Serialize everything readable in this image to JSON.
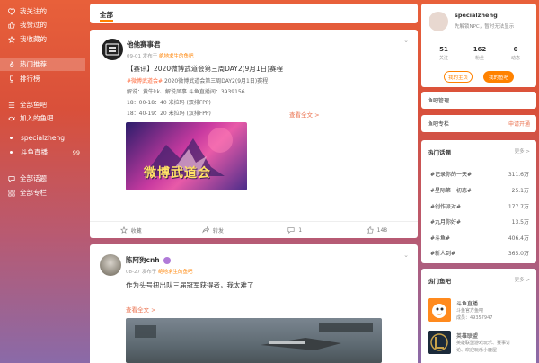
{
  "sidebar": {
    "items": [
      {
        "label": "我关注的",
        "icon": "heart-icon"
      },
      {
        "label": "我赞过的",
        "icon": "thumb-icon"
      },
      {
        "label": "我收藏的",
        "icon": "star-icon"
      },
      {
        "label": "热门推荐",
        "icon": "flame-icon"
      },
      {
        "label": "排行榜",
        "icon": "trophy-icon"
      },
      {
        "label": "全部鱼吧",
        "icon": "list-icon"
      },
      {
        "label": "加入的鱼吧",
        "icon": "fish-icon"
      },
      {
        "label": "specialzheng"
      },
      {
        "label": "斗鱼直播",
        "count": "99"
      },
      {
        "label": "全部话题",
        "icon": "chat-icon"
      },
      {
        "label": "全部专栏",
        "icon": "grid-icon"
      }
    ]
  },
  "feed": {
    "tab": "全部",
    "posts": [
      {
        "author": "他他赛事君",
        "date": "09-01",
        "from_prefix": "发布于",
        "source": "绝地求生的鱼吧",
        "title": "【赛讯】2020微博武道会第三周DAY2(9月1日)赛程",
        "tag": "#微博武道会#",
        "line1_rest": " 2020微博武道会第三周DAY2(9月1日)赛程:",
        "line2": "解说：黄牛kk、解说凤事   斗鱼直播间：3939156",
        "line3": "18：00-18：40  米拉玛 (双排FPP)",
        "line4": "18：40-19：20  米拉玛 (双排FPP)",
        "more": "查看全文 >",
        "image_text": "微博武道会",
        "actions": {
          "collect": "收藏",
          "share": "转发",
          "comment": "1",
          "like": "148"
        }
      },
      {
        "author": "陈阿狗cnh",
        "date": "08-27",
        "from_prefix": "发布于",
        "source": "绝地求生的鱼吧",
        "title": "作为头号扭出队三届冠军获得者，我太难了",
        "more": "查看全文 >"
      }
    ]
  },
  "profile": {
    "name": "specialzheng",
    "sub": "先解锁NPC，暂时无法显示",
    "stats": [
      {
        "n": "51",
        "l": "关注"
      },
      {
        "n": "162",
        "l": "粉丝"
      },
      {
        "n": "0",
        "l": "动态"
      }
    ],
    "btn_home": "我的主页",
    "btn_bar": "我的鱼吧"
  },
  "manage": {
    "label": "鱼吧管理"
  },
  "column": {
    "label": "鱼吧专栏",
    "apply": "申请开通"
  },
  "hot_topics": {
    "title": "热门话题",
    "more": "更多 >",
    "items": [
      {
        "name": "#记录你的一天#",
        "count": "311.6万"
      },
      {
        "name": "#星际第一初恋#",
        "count": "25.1万"
      },
      {
        "name": "#创作派对#",
        "count": "177.7万"
      },
      {
        "name": "#九月你好#",
        "count": "13.5万"
      },
      {
        "name": "#斗鱼#",
        "count": "406.4万"
      },
      {
        "name": "#新人到#",
        "count": "365.0万"
      }
    ]
  },
  "hot_bars": {
    "title": "热门鱼吧",
    "more": "更多 >",
    "items": [
      {
        "name": "斗鱼直播",
        "desc": "斗鱼官方鱼吧",
        "desc2": "成员：49357947"
      },
      {
        "name": "英雄联盟",
        "desc": "英雄联盟游戏玩乐、赛事讨",
        "desc2": "论、欢迎玩乐小鹿屋"
      }
    ]
  }
}
